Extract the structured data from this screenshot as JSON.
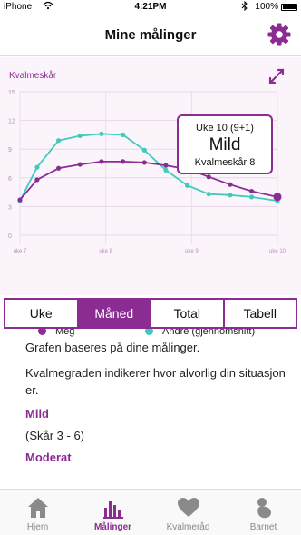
{
  "status_bar": {
    "carrier": "iPhone",
    "time": "4:21PM",
    "battery": "100%"
  },
  "nav": {
    "title": "Mine målinger",
    "settings_icon": "gear-icon"
  },
  "chart_data": {
    "type": "line",
    "ylabel": "Kvalmeskår",
    "ylim": [
      0,
      15
    ],
    "y_ticks": [
      "15",
      "12",
      "9",
      "6",
      "3",
      "0"
    ],
    "x_tick_labels": [
      "uke 7",
      "uke 8",
      "uke 9",
      "uke 10"
    ],
    "xlim": [
      7,
      10
    ],
    "grid": true,
    "series": [
      {
        "name": "Meg",
        "color": "#8b2c93",
        "x": [
          7,
          7.2,
          7.45,
          7.7,
          7.95,
          8.2,
          8.45,
          8.7,
          8.95,
          9.2,
          9.45,
          9.7,
          10
        ],
        "y": [
          3.7,
          5.8,
          7.0,
          7.4,
          7.7,
          7.7,
          7.6,
          7.3,
          6.9,
          6.1,
          5.3,
          4.6,
          4.0
        ]
      },
      {
        "name": "Andre (gjennomsnitt)",
        "color": "#3fcbbb",
        "x": [
          7,
          7.2,
          7.45,
          7.7,
          7.95,
          8.2,
          8.45,
          8.7,
          8.95,
          9.2,
          9.45,
          9.7,
          10
        ],
        "y": [
          3.6,
          7.1,
          9.9,
          10.4,
          10.6,
          10.5,
          8.9,
          6.8,
          5.2,
          4.3,
          4.2,
          4.0,
          3.6
        ]
      }
    ],
    "highlight": {
      "series": "Meg",
      "week_label": "Uke 10 (9+1)",
      "level": "Mild",
      "score_label": "Kvalmeskår 8"
    },
    "legend": [
      "Meg",
      "Andre (gjennomsnitt)"
    ],
    "legend_position": "bottom"
  },
  "segments": {
    "items": [
      "Uke",
      "Måned",
      "Total",
      "Tabell"
    ],
    "active": "Måned"
  },
  "info": {
    "line1": "Grafen baseres på dine målinger.",
    "line2": "Kvalmegraden indikerer hvor alvorlig din situasjon er.",
    "level1_name": "Mild",
    "level1_range": "(Skår 3 - 6)",
    "level2_name": "Moderat"
  },
  "tabs": [
    {
      "label": "Hjem",
      "icon": "house-icon"
    },
    {
      "label": "Målinger",
      "icon": "bar-chart-icon"
    },
    {
      "label": "Kvalmeråd",
      "icon": "heart-icon"
    },
    {
      "label": "Barnet",
      "icon": "baby-icon"
    }
  ],
  "active_tab": "Målinger",
  "colors": {
    "accent": "#8b2c93",
    "secondary": "#3fcbbb",
    "panel_bg": "#fbf5fb"
  }
}
